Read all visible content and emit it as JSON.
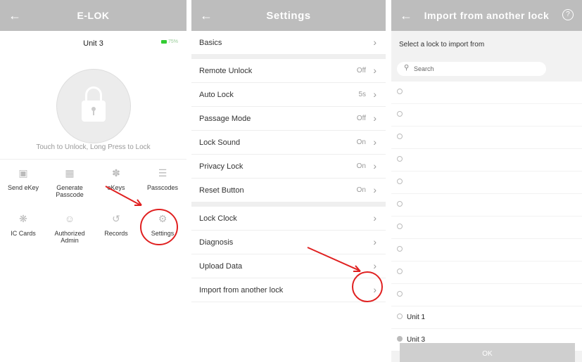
{
  "panel1": {
    "title": "E-LOK",
    "unit": "Unit 3",
    "battery": "75%",
    "touch_hint": "Touch to Unlock, Long Press to Lock",
    "grid_row1": [
      {
        "label": "Send eKey",
        "icon": "ekey-icon"
      },
      {
        "label": "Generate Passcode",
        "icon": "keypad-icon"
      },
      {
        "label": "eKeys",
        "icon": "people-icon"
      },
      {
        "label": "Passcodes",
        "icon": "list-icon"
      }
    ],
    "grid_row2": [
      {
        "label": "IC Cards",
        "icon": "card-icon"
      },
      {
        "label": "Authorized Admin",
        "icon": "admin-icon"
      },
      {
        "label": "Records",
        "icon": "history-icon"
      },
      {
        "label": "Settings",
        "icon": "gear-icon"
      }
    ]
  },
  "panel2": {
    "title": "Settings",
    "groups": [
      [
        {
          "label": "Basics",
          "value": ""
        }
      ],
      [
        {
          "label": "Remote Unlock",
          "value": "Off"
        },
        {
          "label": "Auto Lock",
          "value": "5s"
        },
        {
          "label": "Passage Mode",
          "value": "Off"
        },
        {
          "label": "Lock Sound",
          "value": "On"
        },
        {
          "label": "Privacy Lock",
          "value": "On"
        },
        {
          "label": "Reset Button",
          "value": "On"
        }
      ],
      [
        {
          "label": "Lock Clock",
          "value": ""
        },
        {
          "label": "Diagnosis",
          "value": ""
        },
        {
          "label": "Upload Data",
          "value": ""
        },
        {
          "label": "Import from another lock",
          "value": ""
        }
      ]
    ]
  },
  "panel3": {
    "title": "Import from another lock",
    "help": "?",
    "select_title": "Select a lock to import from",
    "search_placeholder": "Search",
    "locks": [
      "",
      "",
      "",
      "",
      "",
      "",
      "",
      "",
      "",
      "",
      "Unit 1",
      "Unit 3"
    ],
    "selected_index": 11,
    "ok_label": "OK"
  },
  "colors": {
    "annotation": "#e02020",
    "header": "#bdbdbd"
  }
}
